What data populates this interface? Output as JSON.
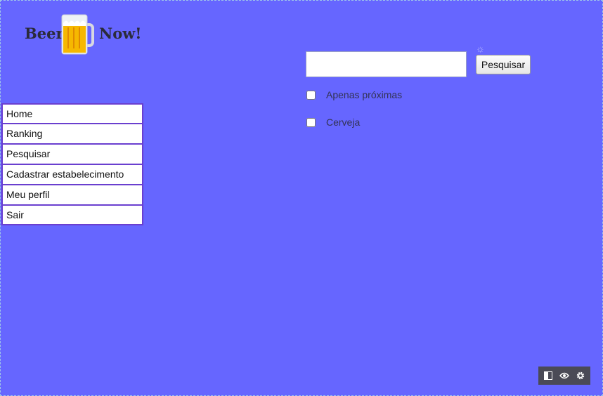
{
  "brand": {
    "text_left": "Beer",
    "text_right": "Now!"
  },
  "nav": {
    "items": [
      {
        "label": "Home"
      },
      {
        "label": "Ranking"
      },
      {
        "label": "Pesquisar"
      },
      {
        "label": "Cadastrar estabelecimento"
      },
      {
        "label": "Meu perfil"
      },
      {
        "label": "Sair"
      }
    ]
  },
  "search": {
    "value": "",
    "button_label": "Pesquisar",
    "filters": [
      {
        "label": "Apenas próximas",
        "checked": false
      },
      {
        "label": "Cerveja",
        "checked": false
      }
    ]
  },
  "toolbar": {
    "icons": [
      "sidebar-toggle-icon",
      "eye-icon",
      "gear-icon"
    ]
  },
  "colors": {
    "background": "#6666ff",
    "nav_border": "#6a3fcf",
    "beer": "#f6b800"
  }
}
